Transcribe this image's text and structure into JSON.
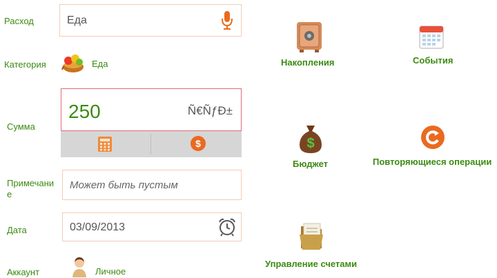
{
  "form": {
    "expense_label": "Расход",
    "expense_value": "Еда",
    "category_label": "Категория",
    "category_value": "Еда",
    "amount_label": "Сумма",
    "amount_value": "250",
    "currency_text": "Ñ€ÑƒÐ±",
    "note_label_line1": "Примечани",
    "note_label_line2": "е",
    "note_placeholder": "Может быть пустым",
    "date_label": "Дата",
    "date_value": "03/09/2013",
    "account_label": "Аккаунт",
    "account_value": "Личное"
  },
  "tiles": {
    "savings": "Накопления",
    "events": "События",
    "budget": "Бюджет",
    "recurring": "Повторяющиеся операции",
    "accounts": "Управление счетами"
  },
  "colors": {
    "accent_green": "#3c8a12",
    "field_border": "#f3cdb6",
    "amount_border": "#e06c75",
    "orange": "#ea6a1f"
  }
}
